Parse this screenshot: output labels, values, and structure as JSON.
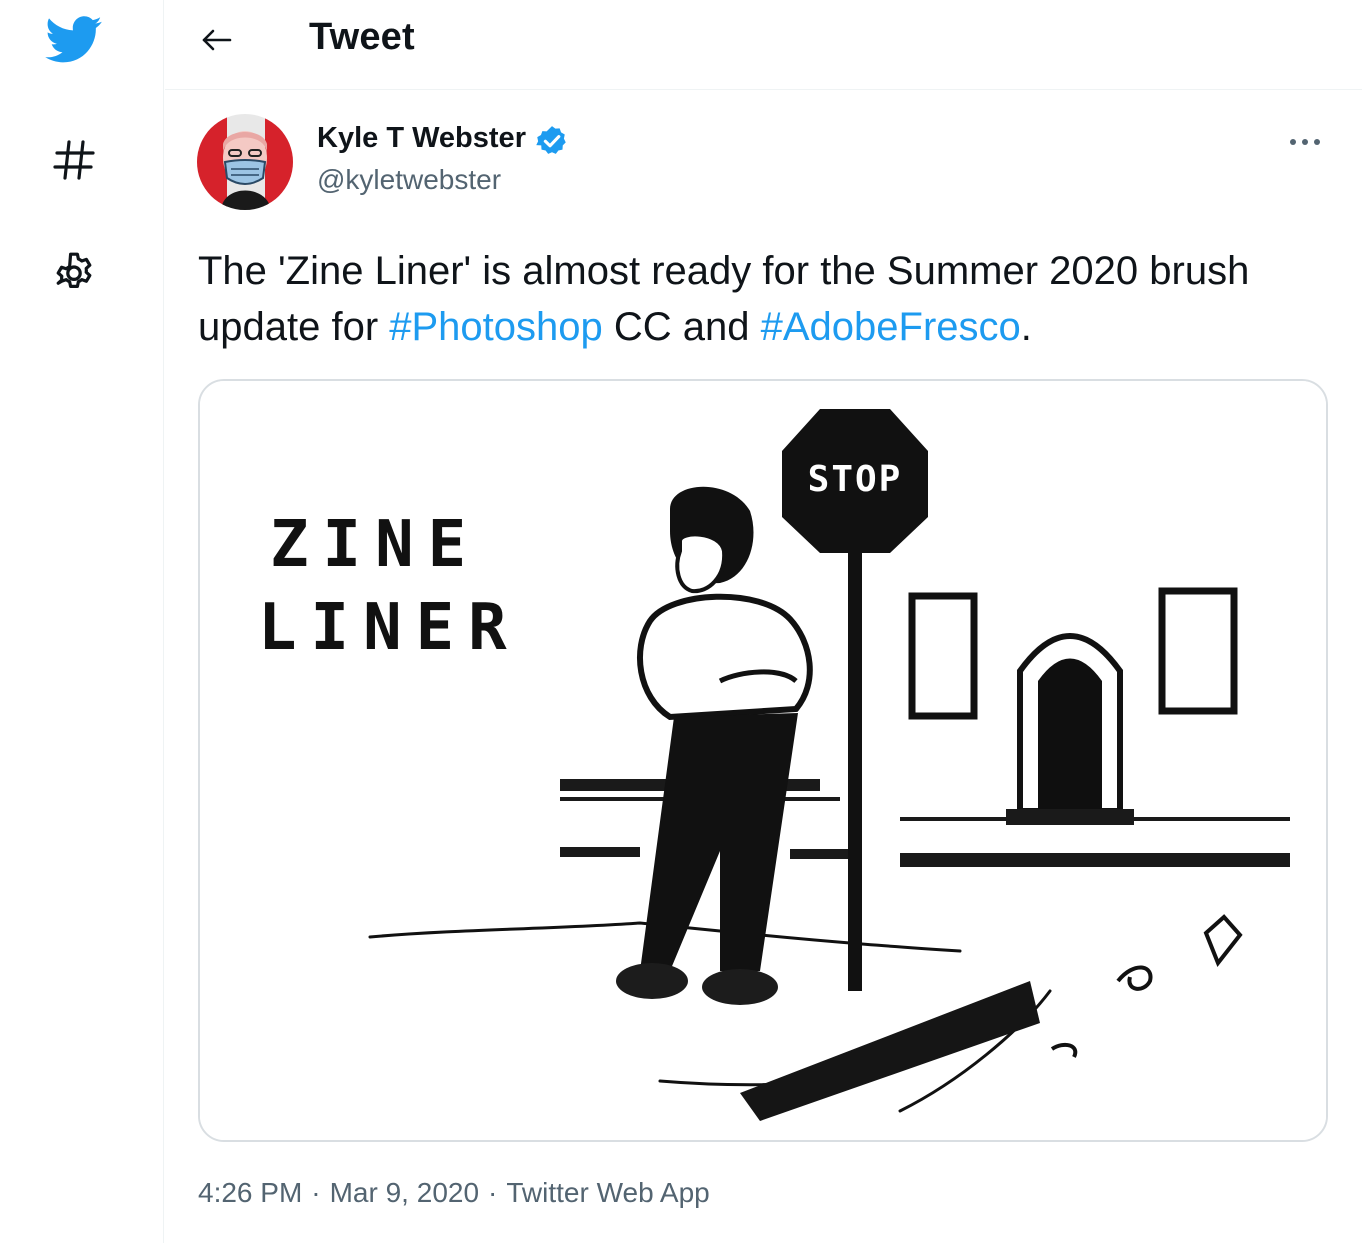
{
  "nav": {
    "items": [
      {
        "icon": "twitter-bird-icon"
      },
      {
        "icon": "hashtag-icon"
      },
      {
        "icon": "gear-icon"
      }
    ],
    "brand_color": "#1d9bf0"
  },
  "header": {
    "title": "Tweet",
    "back_icon": "arrow-left-icon"
  },
  "tweet": {
    "author": {
      "name": "Kyle T Webster",
      "handle": "@kyletwebster",
      "verified": true
    },
    "text": {
      "part1": "The 'Zine Liner' is almost ready for the Summer 2020 brush update for ",
      "hashtag1": "#Photoshop",
      "part2": " CC and ",
      "hashtag2": "#AdobeFresco",
      "part3": "."
    },
    "media": {
      "title_line1": "ZINE",
      "title_line2": "LINER",
      "sign_text": "STOP"
    },
    "time": "4:26 PM",
    "date": "Mar 9, 2020",
    "source": "Twitter Web App",
    "separator": "·"
  },
  "colors": {
    "link": "#1d9bf0",
    "secondary_text": "#536471",
    "border": "#d9dee2"
  }
}
